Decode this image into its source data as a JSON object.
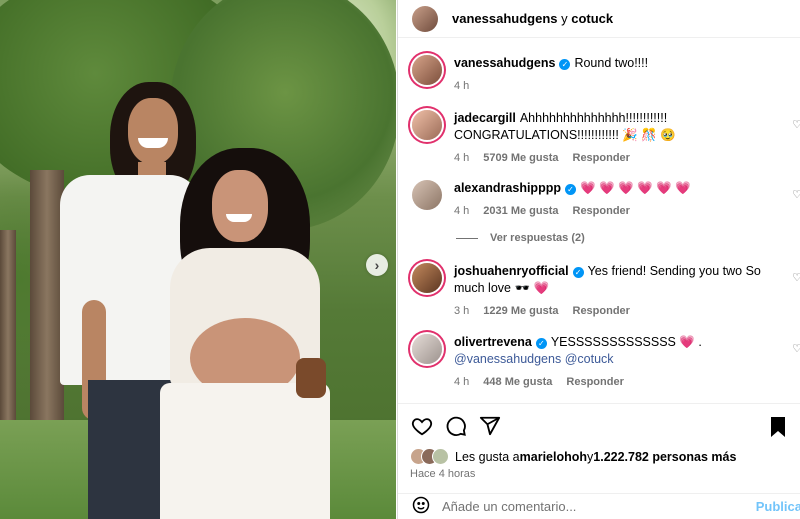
{
  "header": {
    "user1": "vanessahudgens",
    "joiner": " y ",
    "user2": "cotuck"
  },
  "caption": {
    "user": "vanessahudgens",
    "text": "Round two!!!!",
    "time": "4 h"
  },
  "comments": [
    {
      "user": "jadecargill",
      "text": "Ahhhhhhhhhhhhhh!!!!!!!!!!!! CONGRATULATIONS!!!!!!!!!!!! 🎉 🎊 🥹",
      "time": "4 h",
      "likes": "5709 Me gusta",
      "reply": "Responder"
    },
    {
      "user": "alexandrashipppp",
      "text": "💗 💗 💗 💗 💗 💗",
      "time": "4 h",
      "likes": "2031 Me gusta",
      "reply": "Responder"
    },
    {
      "user": "joshuahenryofficial",
      "text": "Yes friend! Sending you two So much love 🕶️ 💗",
      "time": "3 h",
      "likes": "1229 Me gusta",
      "reply": "Responder"
    },
    {
      "user": "olivertrevena",
      "text_before": "YESSSSSSSSSSSSS 💗 .",
      "mention1": "@vanessahudgens",
      "mention2": "@cotuck",
      "time": "4 h",
      "likes": "448 Me gusta",
      "reply": "Responder"
    }
  ],
  "view_replies": "Ver respuestas (2)",
  "likes_line": {
    "prefix": "Les gusta a ",
    "user": "marielohoh",
    "middle": " y ",
    "count": "1.222.782 personas más"
  },
  "posted_time": "Hace 4 horas",
  "add_comment": {
    "placeholder": "Añade un comentario...",
    "publish": "Publica"
  },
  "icons": [
    "heart-icon",
    "comment-icon",
    "share-icon",
    "bookmark-icon",
    "emoji-icon",
    "chevron-right-icon",
    "verified-icon"
  ],
  "colors": {
    "verified": "#0095f6",
    "story_ring": "#e1306c",
    "mention": "#3d5a98",
    "muted": "#737373"
  }
}
